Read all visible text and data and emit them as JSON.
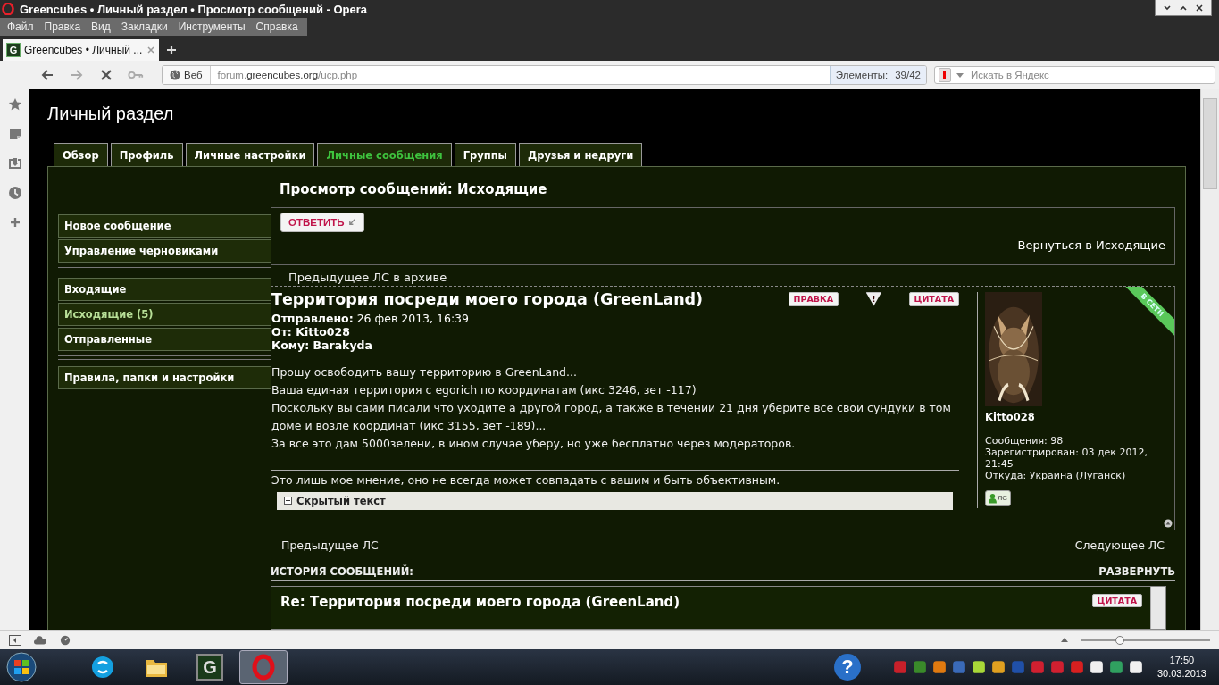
{
  "window": {
    "title": "Greencubes • Личный раздел • Просмотр сообщений - Opera"
  },
  "menu": [
    "Файл",
    "Правка",
    "Вид",
    "Закладки",
    "Инструменты",
    "Справка"
  ],
  "tabs": [
    {
      "label": "Greencubes • Личный ...",
      "favicon": "G",
      "selected": true
    }
  ],
  "address_bar": {
    "mode": "Веб",
    "url_prefix": "forum.",
    "url_domain": "greencubes.org",
    "url_path": "/ucp.php",
    "elements_label": "Элементы:",
    "elements_count": "39/42"
  },
  "search": {
    "placeholder": "Искать в Яндекс"
  },
  "page": {
    "title": "Личный раздел",
    "tabs": [
      {
        "label": "Обзор",
        "selected": false
      },
      {
        "label": "Профиль",
        "selected": false
      },
      {
        "label": "Личные настройки",
        "selected": false
      },
      {
        "label": "Личные сообщения",
        "selected": true
      },
      {
        "label": "Группы",
        "selected": false
      },
      {
        "label": "Друзья и недруги",
        "selected": false
      }
    ],
    "sidebar": [
      [
        {
          "label": "Новое сообщение",
          "selected": false
        },
        {
          "label": "Управление черновиками",
          "selected": false
        }
      ],
      [
        {
          "label": "Входящие",
          "selected": false
        },
        {
          "label": "Исходящие (5)",
          "selected": true
        },
        {
          "label": "Отправленные",
          "selected": false
        }
      ],
      [
        {
          "label": "Правила, папки и настройки",
          "selected": false
        }
      ]
    ],
    "heading": "Просмотр сообщений: Исходящие",
    "reply_button": "ОТВЕТИТЬ",
    "back_link": "Вернуться в Исходящие",
    "prev_archive": "Предыдущее ЛС в архиве",
    "message": {
      "subject": "Территория посреди моего города (GreenLand)",
      "actions": [
        {
          "kind": "edit",
          "label": "ПРАВКА"
        },
        {
          "kind": "report",
          "label": "!"
        },
        {
          "kind": "quote",
          "label": "ЦИТАТА"
        }
      ],
      "meta": [
        "**Отправлено:** 26 фев 2013, 16:39",
        "От: Kitto028",
        "Кому: Barakyda"
      ],
      "body": [
        "Прошу освободить вашу территорию в GreenLand...",
        "Ваша единая территория с egorich по координатам (икс 3246, зет -117)",
        "Поскольку вы сами писали что уходите а другой город, а также в течении 21 дня уберите все свои сундуки в том доме и возле координат (икс 3155, зет -189)...",
        "За все это дам 5000зелени, в ином случае уберу, но уже бесплатно через модераторов."
      ],
      "signature": "Это лишь мое мнение, оно не всегда может совпадать с вашим и быть объективным.",
      "spoiler": "Скрытый текст",
      "author": {
        "name": "Kitto028",
        "online_badge": "В СЕТИ",
        "stats": [
          "Сообщения: 98",
          "Зарегистрирован: 03 дек 2012, 21:45",
          "Откуда: Украина (Луганск)"
        ],
        "pm_button": "ЛС"
      }
    },
    "prev": "Предыдущее ЛС",
    "next": "Следующее ЛС",
    "history_title": "ИСТОРИЯ СООБЩЕНИЙ:",
    "expand": "РАЗВЕРНУТЬ",
    "history": [
      {
        "subject": "Re: Территория посреди моего города (GreenLand)",
        "quote": "ЦИТАТА"
      }
    ]
  },
  "status_bar": {
    "zoom": {
      "level": 0.3
    }
  },
  "taskbar": {
    "apps": [
      {
        "kind": "skype",
        "active": false
      },
      {
        "kind": "folder",
        "active": false
      },
      {
        "kind": "greencubes",
        "label": "G",
        "active": false
      },
      {
        "kind": "opera",
        "active": true
      }
    ],
    "help": "?",
    "clock_time": "17:50",
    "clock_date": "30.03.2013"
  }
}
